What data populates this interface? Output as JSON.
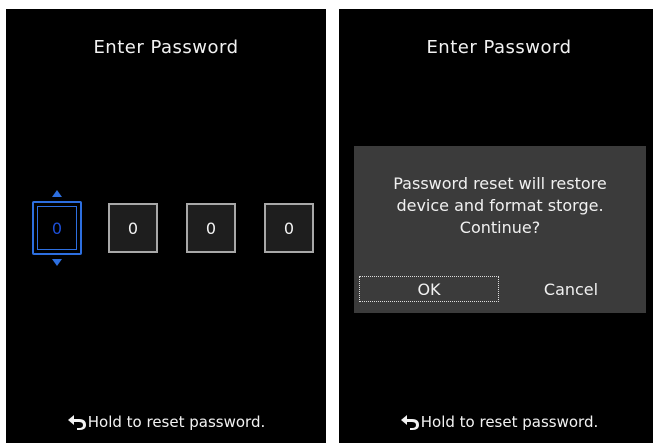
{
  "screens": [
    {
      "title": "Enter Password",
      "digits": [
        "0",
        "0",
        "0",
        "0"
      ],
      "active_digit_index": 0,
      "footer_text": "Hold to reset password."
    },
    {
      "title": "Enter Password",
      "dialog": {
        "message_lines": [
          "Password reset will restore",
          "device and format storge.",
          "Continue?"
        ],
        "ok_label": "OK",
        "cancel_label": "Cancel",
        "focused_button": "ok"
      },
      "footer_text": "Hold to reset password."
    }
  ],
  "icons": {
    "footer_icon": "back-arrow-icon",
    "digit_spinner_icons": [
      "arrow-up-icon",
      "arrow-down-icon"
    ]
  },
  "colors": {
    "screen_background": "#000000",
    "text": "#f2f2f2",
    "accent_focus": "#2d6fe0",
    "dialog_background": "#3b3b3b",
    "digit_border": "#a8a8a8"
  }
}
